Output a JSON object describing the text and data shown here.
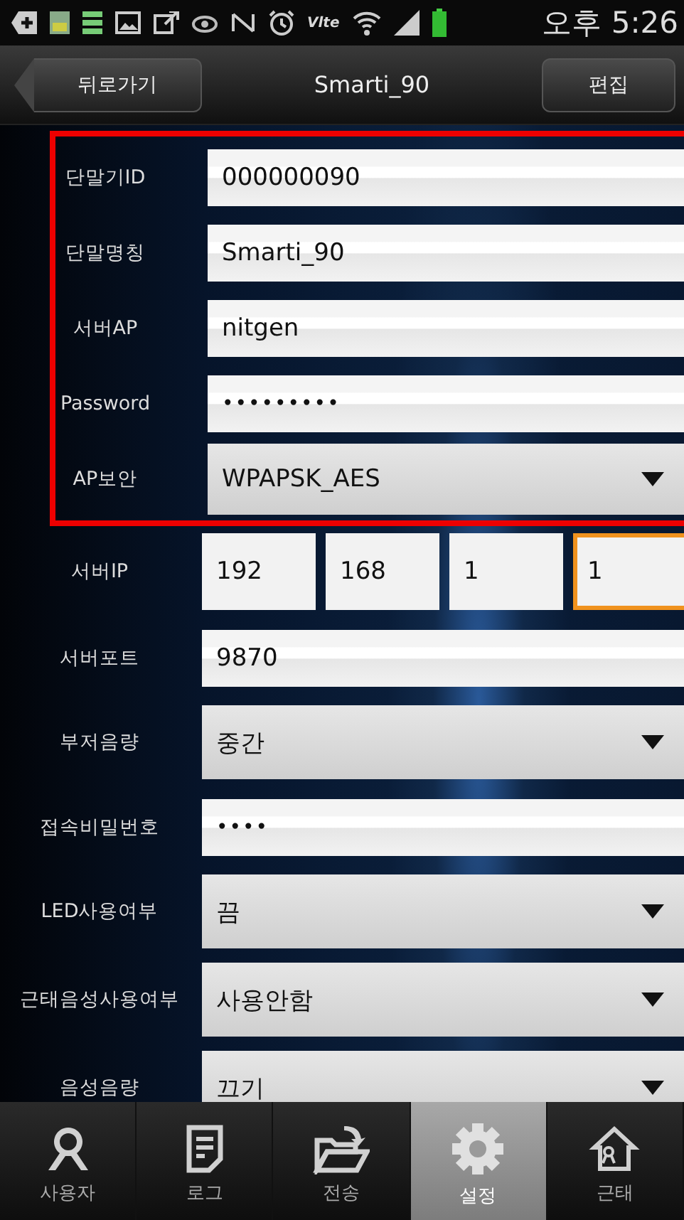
{
  "status_bar": {
    "time": "오후 5:26",
    "network": "Vlte"
  },
  "header": {
    "back_button": "뒤로가기",
    "title": "Smarti_90",
    "edit_button": "편집"
  },
  "fields": [
    {
      "label": "단말기ID",
      "kind": "text",
      "value": "000000090",
      "highlighted": true
    },
    {
      "label": "단말명칭",
      "kind": "text",
      "value": "Smarti_90",
      "highlighted": true
    },
    {
      "label": "서버AP",
      "kind": "text",
      "value": "nitgen",
      "highlighted": true
    },
    {
      "label": "Password",
      "kind": "password",
      "value": "•••••••••",
      "highlighted": true
    },
    {
      "label": "AP보안",
      "kind": "select",
      "value": "WPAPSK_AES",
      "highlighted": true
    },
    {
      "label": "서버IP",
      "kind": "ip",
      "parts": [
        {
          "value": "192",
          "focused": false
        },
        {
          "value": "168",
          "focused": false
        },
        {
          "value": "1",
          "focused": false
        },
        {
          "value": "1",
          "focused": true
        }
      ],
      "highlighted": false
    },
    {
      "label": "서버포트",
      "kind": "text",
      "value": "9870",
      "highlighted": false
    },
    {
      "label": "부저음량",
      "kind": "select",
      "value": "중간",
      "highlighted": false
    },
    {
      "label": "접속비밀번호",
      "kind": "password",
      "value": "••••",
      "highlighted": false
    },
    {
      "label": "LED사용여부",
      "kind": "select",
      "value": "끔",
      "highlighted": false
    },
    {
      "label": "근태음성사용여부",
      "kind": "select",
      "value": "사용안함",
      "highlighted": false
    },
    {
      "label": "음성음량",
      "kind": "select",
      "value": "끄기",
      "highlighted": false
    }
  ],
  "tabs": [
    {
      "label": "사용자",
      "selected": false
    },
    {
      "label": "로그",
      "selected": false
    },
    {
      "label": "전송",
      "selected": false
    },
    {
      "label": "설정",
      "selected": true
    },
    {
      "label": "근태",
      "selected": false
    }
  ]
}
